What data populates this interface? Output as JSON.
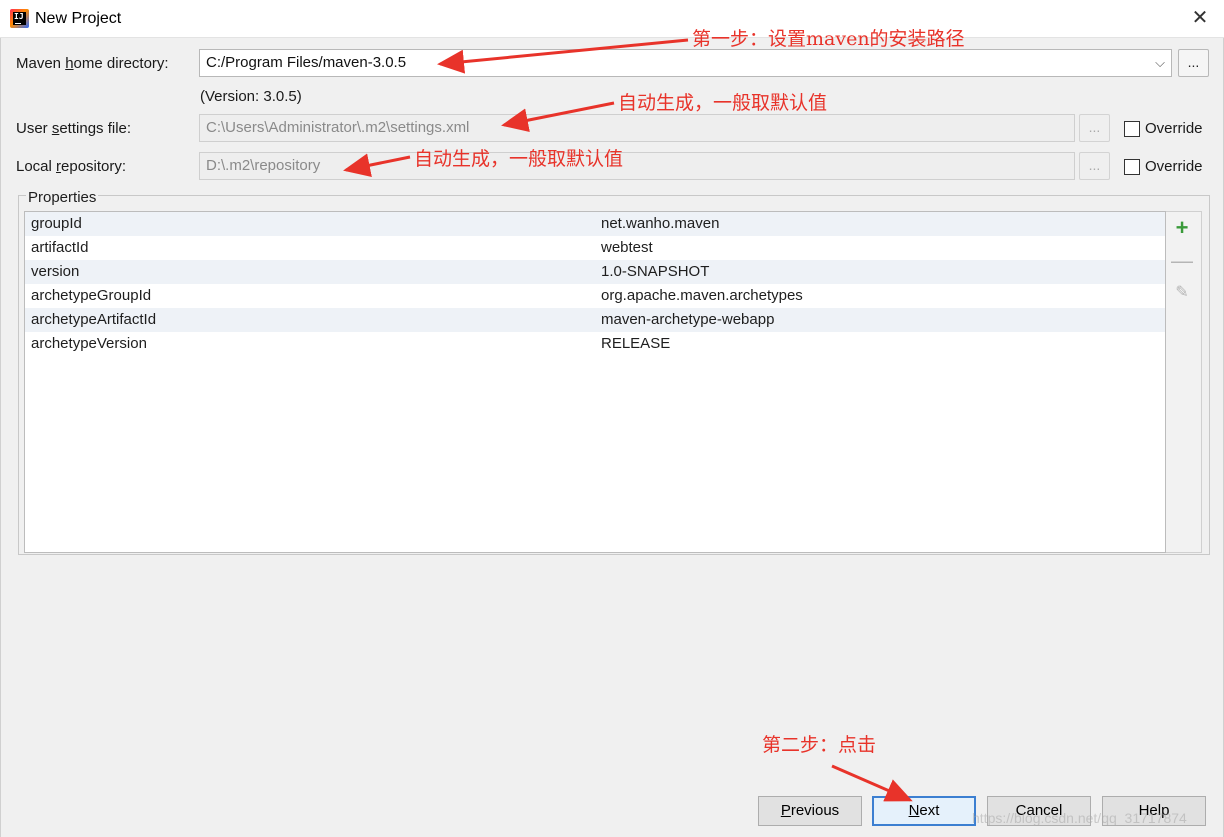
{
  "window": {
    "title": "New Project",
    "app_icon_text": "IJ",
    "close_glyph": "✕"
  },
  "maven_home": {
    "label_pre": "Maven ",
    "label_mnemonic": "h",
    "label_post": "ome directory:",
    "value": "C:/Program Files/maven-3.0.5",
    "version_text": "(Version: 3.0.5)",
    "browse_label": "...",
    "dropdown_glyph": "⌵"
  },
  "user_settings": {
    "label_pre": "User ",
    "label_mnemonic": "s",
    "label_post": "ettings file:",
    "value": "C:\\Users\\Administrator\\.m2\\settings.xml",
    "browse_label": "...",
    "override_label": "Override",
    "override_checked": false
  },
  "local_repo": {
    "label_pre": "Local ",
    "label_mnemonic": "r",
    "label_post": "epository:",
    "value": "D:\\.m2\\repository",
    "browse_label": "...",
    "override_label": "Override",
    "override_checked": false
  },
  "properties": {
    "legend": "Properties",
    "rows": [
      {
        "key": "groupId",
        "value": "net.wanho.maven"
      },
      {
        "key": "artifactId",
        "value": "webtest"
      },
      {
        "key": "version",
        "value": "1.0-SNAPSHOT"
      },
      {
        "key": "archetypeGroupId",
        "value": "org.apache.maven.archetypes"
      },
      {
        "key": "archetypeArtifactId",
        "value": "maven-archetype-webapp"
      },
      {
        "key": "archetypeVersion",
        "value": "RELEASE"
      }
    ],
    "toolbar": {
      "add_glyph": "+",
      "remove_glyph": "—",
      "edit_glyph": "✎"
    }
  },
  "buttons": {
    "previous": {
      "mnemonic": "P",
      "rest": "revious"
    },
    "next": {
      "mnemonic": "N",
      "rest": "ext"
    },
    "cancel": "Cancel",
    "help": "Help"
  },
  "annotations": {
    "step1": "第一步：设置maven的安装路径",
    "auto1": "自动生成，一般取默认值",
    "auto2": "自动生成，一般取默认值",
    "step2": "第二步：点击"
  },
  "watermark": "https://blog.csdn.net/qq_31717874",
  "colors": {
    "annotation_red": "#e8332a",
    "default_button_border": "#3c7fd1",
    "add_green": "#3a9a3a"
  }
}
